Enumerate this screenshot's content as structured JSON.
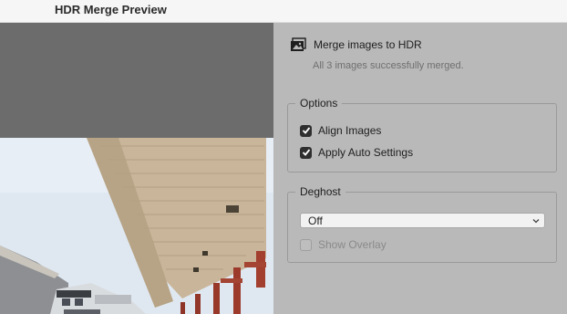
{
  "window": {
    "title": "HDR Merge Preview"
  },
  "header": {
    "icon": "images-icon",
    "label": "Merge images to HDR",
    "status": "All 3 images successfully merged."
  },
  "options": {
    "legend": "Options",
    "items": [
      {
        "label": "Align Images",
        "checked": true
      },
      {
        "label": "Apply Auto Settings",
        "checked": true
      }
    ]
  },
  "deghost": {
    "legend": "Deghost",
    "select_value": "Off",
    "overlay": {
      "label": "Show Overlay",
      "checked": false,
      "enabled": false
    }
  },
  "colors": {
    "panel_bg": "#b9b9b9",
    "preview_bg": "#6c6c6c",
    "titlebar_bg": "#f6f6f6",
    "checkbox_checked": "#2f2f2f"
  }
}
